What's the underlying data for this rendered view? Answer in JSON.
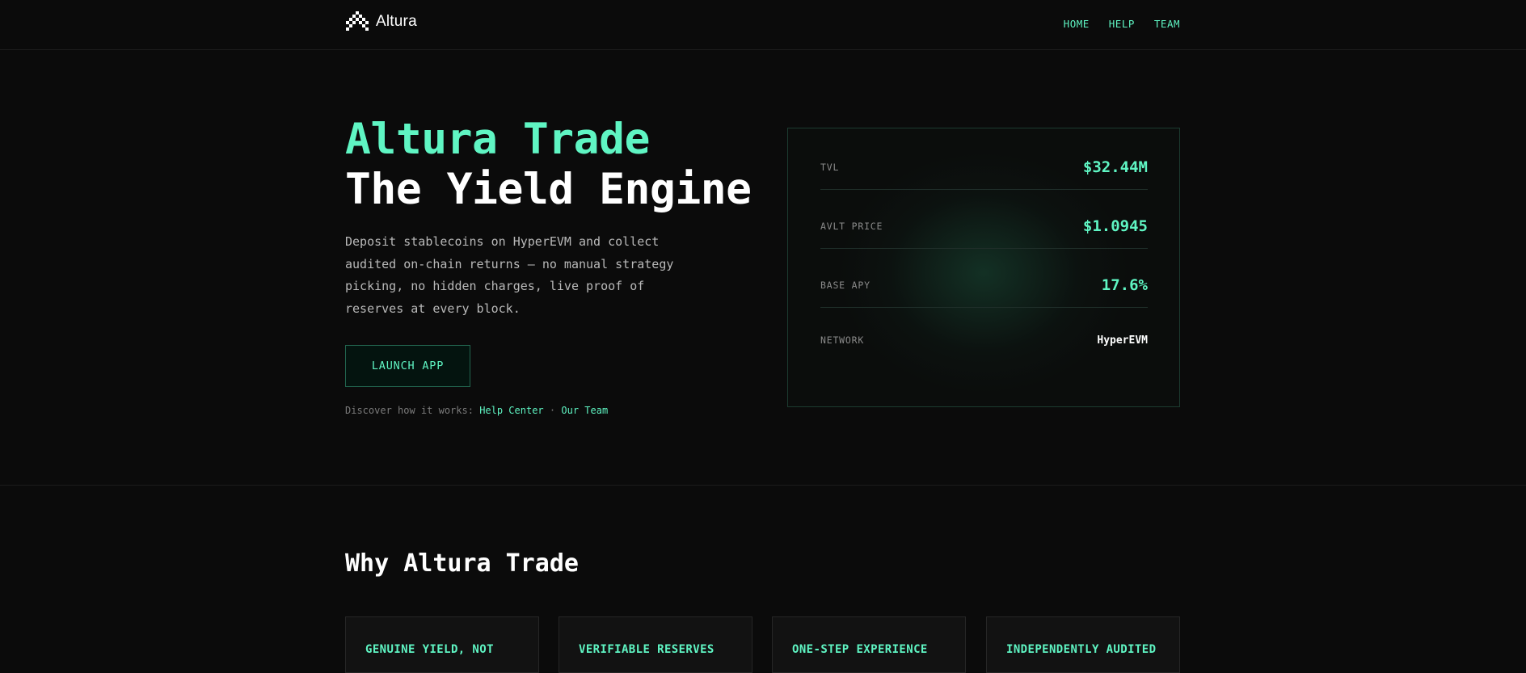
{
  "brand": {
    "name": "Altura"
  },
  "nav": {
    "links": [
      "HOME",
      "HELP",
      "TEAM"
    ]
  },
  "hero": {
    "title_line1": "Altura Trade",
    "title_line2": "The Yield Engine",
    "description": "Deposit stablecoins on HyperEVM and collect audited on-chain returns — no manual strategy picking, no hidden charges, live proof of reserves at every block.",
    "cta_label": "LAUNCH APP",
    "discover_prefix": "Discover how it works:",
    "help_link": "Help Center",
    "separator": "·",
    "team_link": "Our Team"
  },
  "stats": [
    {
      "label": "TVL",
      "value": "$32.44M"
    },
    {
      "label": "AVLT PRICE",
      "value": "$1.0945"
    },
    {
      "label": "BASE APY",
      "value": "17.6%"
    },
    {
      "label": "NETWORK",
      "value": "HyperEVM"
    }
  ],
  "why": {
    "title": "Why Altura Trade",
    "features": [
      "GENUINE YIELD, NOT",
      "VERIFIABLE RESERVES",
      "ONE-STEP EXPERIENCE",
      "INDEPENDENTLY AUDITED"
    ]
  },
  "colors": {
    "accent": "#5ff5c3",
    "background": "#0b0b0b",
    "card_border": "#1c3b30"
  },
  "icons": {
    "logo": "altura-logo-icon"
  }
}
